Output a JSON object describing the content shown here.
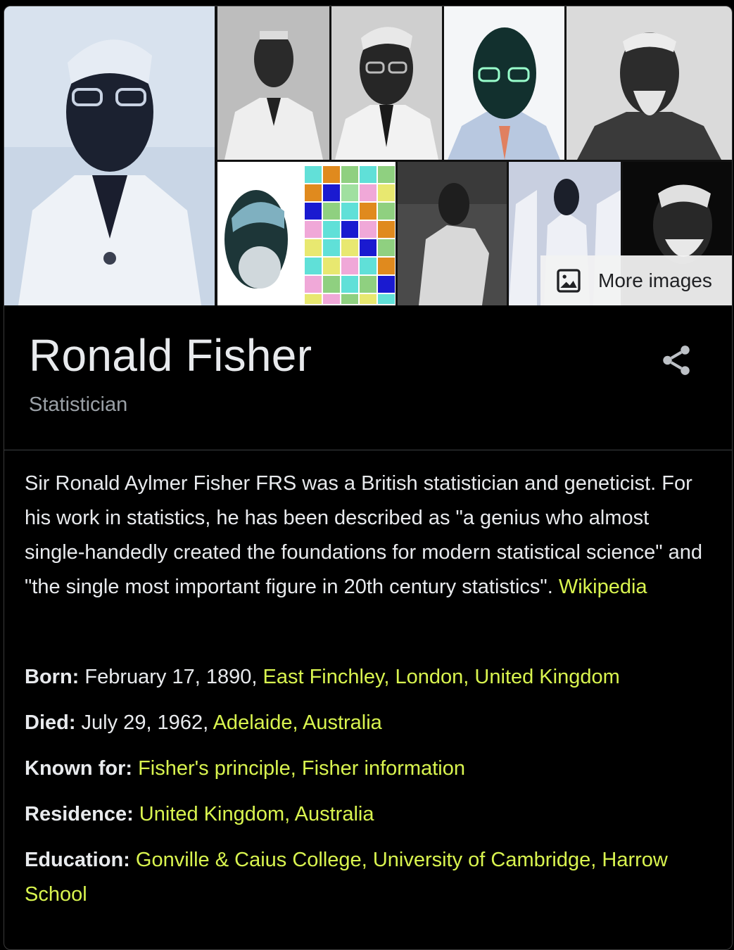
{
  "images": {
    "more_images_label": "More images"
  },
  "header": {
    "title": "Ronald Fisher",
    "subtitle": "Statistician"
  },
  "description": {
    "text": "Sir Ronald Aylmer Fisher FRS was a British statistician and geneticist. For his work in statistics, he has been described as \"a genius who almost single-handedly created the foundations for modern statistical science\" and \"the single most important figure in 20th century statistics\". ",
    "source_link": "Wikipedia"
  },
  "facts": {
    "born": {
      "label": "Born:",
      "text": " February 17, 1890, ",
      "link": "East Finchley, London, United Kingdom"
    },
    "died": {
      "label": "Died:",
      "text": " July 29, 1962, ",
      "link": "Adelaide, Australia"
    },
    "known_for": {
      "label": "Known for:",
      "link1": "Fisher's principle",
      "sep": ", ",
      "link2": "Fisher information"
    },
    "residence": {
      "label": "Residence:",
      "link1": "United Kingdom",
      "sep": ", ",
      "link2": "Australia"
    },
    "education": {
      "label": "Education:",
      "link1": "Gonville & Caius College",
      "sep": ", ",
      "link2": "University of Cambridge",
      "sep2": ", ",
      "link3": "Harrow School"
    }
  },
  "colors": {
    "link": "#d9f44f",
    "text": "#e8eaed",
    "muted": "#9aa0a6",
    "background": "#000000"
  }
}
